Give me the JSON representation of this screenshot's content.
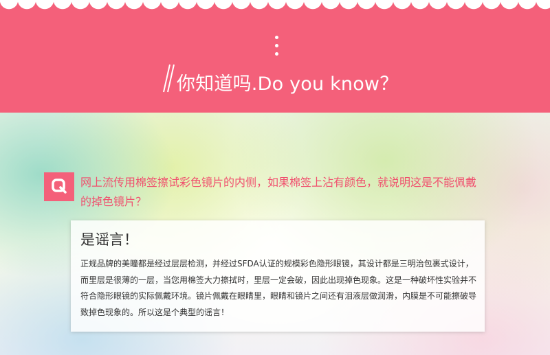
{
  "header": {
    "title": "你知道吗.Do you know？",
    "colors": {
      "banner": "#f4607a",
      "text": "#ffffff"
    }
  },
  "question": {
    "badge_label": "Q",
    "text": "网上流传用棉签擦试彩色镜片的内侧，如果棉签上沾有颜色，就说明这是不能佩戴的掉色镜片？"
  },
  "answer": {
    "heading": "是谣言！",
    "body": "正规品牌的美瞳都是经过层层检测，并经过SFDA认证的规模彩色隐形眼镜，其设计都是三明治包裹式设计，而里层是很薄的一层，当您用棉签大力擦拭时，里层一定会破，因此出现掉色现象。这是一种破坏性实验并不符合隐形眼镜的实际佩戴环境。镜片佩戴在眼睛里，眼睛和镜片之间还有泪液层做润滑，内膜是不可能擦破导致掉色现象的。所以这是个典型的谣言！",
    "colors": {
      "question_text": "#f0506e",
      "body_text": "#333333"
    }
  }
}
